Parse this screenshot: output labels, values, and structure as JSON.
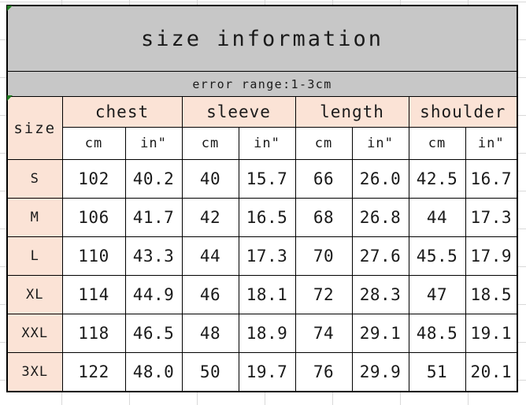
{
  "table": {
    "title": "size information",
    "note": "error range:1-3cm",
    "size_header": "size",
    "groups": [
      "chest",
      "sleeve",
      "length",
      "shoulder"
    ],
    "units": {
      "cm": "cm",
      "in": "in\""
    },
    "unit_row": [
      "cm",
      "in\"",
      "cm",
      "in\"",
      "cm",
      "in\"",
      "cm",
      "in\""
    ],
    "rows": [
      {
        "size": "S",
        "chest_cm": "102",
        "chest_in": "40.2",
        "sleeve_cm": "40",
        "sleeve_in": "15.7",
        "length_cm": "66",
        "length_in": "26.0",
        "shoulder_cm": "42.5",
        "shoulder_in": "16.7"
      },
      {
        "size": "M",
        "chest_cm": "106",
        "chest_in": "41.7",
        "sleeve_cm": "42",
        "sleeve_in": "16.5",
        "length_cm": "68",
        "length_in": "26.8",
        "shoulder_cm": "44",
        "shoulder_in": "17.3"
      },
      {
        "size": "L",
        "chest_cm": "110",
        "chest_in": "43.3",
        "sleeve_cm": "44",
        "sleeve_in": "17.3",
        "length_cm": "70",
        "length_in": "27.6",
        "shoulder_cm": "45.5",
        "shoulder_in": "17.9"
      },
      {
        "size": "XL",
        "chest_cm": "114",
        "chest_in": "44.9",
        "sleeve_cm": "46",
        "sleeve_in": "18.1",
        "length_cm": "72",
        "length_in": "28.3",
        "shoulder_cm": "47",
        "shoulder_in": "18.5"
      },
      {
        "size": "XXL",
        "chest_cm": "118",
        "chest_in": "46.5",
        "sleeve_cm": "48",
        "sleeve_in": "18.9",
        "length_cm": "74",
        "length_in": "29.1",
        "shoulder_cm": "48.5",
        "shoulder_in": "19.1"
      },
      {
        "size": "3XL",
        "chest_cm": "122",
        "chest_in": "48.0",
        "sleeve_cm": "50",
        "sleeve_in": "19.7",
        "length_cm": "76",
        "length_in": "29.9",
        "shoulder_cm": "51",
        "shoulder_in": "20.1"
      }
    ]
  },
  "colors": {
    "title_background": "#c7c7c7",
    "header_background": "#fbe3d6",
    "cell_background": "#ffffff",
    "inch_text": "#e0231a",
    "cm_text": "#1a1a1a",
    "border": "#000000",
    "sheet_gridline": "#d9d9d9",
    "corner_mark": "#1e7a1e"
  }
}
